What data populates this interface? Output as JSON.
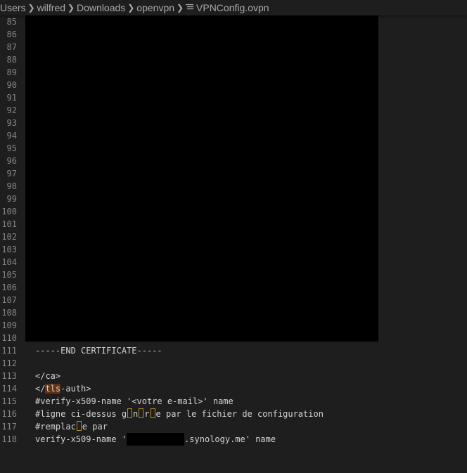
{
  "breadcrumb": {
    "items": [
      "Users",
      "wilfred",
      "Downloads",
      "openvpn"
    ],
    "file": "VPNConfig.ovpn"
  },
  "editor": {
    "hidden_line_numbers": [
      "85",
      "86",
      "87",
      "88",
      "89",
      "90",
      "91",
      "92",
      "93",
      "94",
      "95",
      "96",
      "97",
      "98",
      "99",
      "100",
      "101",
      "102",
      "103",
      "104",
      "105",
      "106",
      "107",
      "108",
      "109",
      "110"
    ],
    "lines": [
      {
        "num": "111",
        "text": "-----END CERTIFICATE-----"
      },
      {
        "num": "112",
        "text": ""
      },
      {
        "num": "113",
        "text": "</ca>"
      },
      {
        "num": "114",
        "pre": "</",
        "hl": "tls",
        "post": "-auth>"
      },
      {
        "num": "115",
        "text": "#verify-x509-name '<votre e-mail>' name"
      },
      {
        "num": "116",
        "pre": "#ligne ci-dessus g",
        "mid1": "n",
        "mid2": "r",
        "post": "e par le fichier de configuration"
      },
      {
        "num": "117",
        "pre": "#remplac",
        "post": "e par"
      },
      {
        "num": "118",
        "pre": "verify-x509-name '",
        "post": ".synology.me' name"
      }
    ]
  }
}
